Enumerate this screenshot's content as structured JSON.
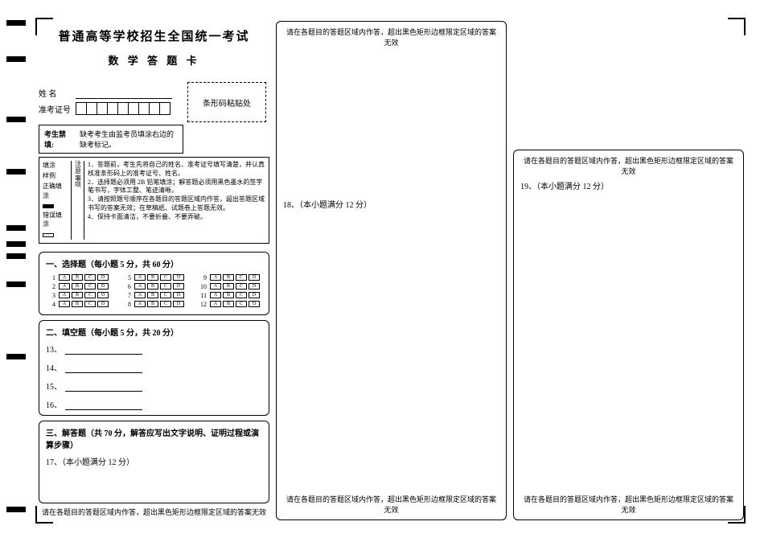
{
  "header": {
    "title": "普通高等学校招生全国统一考试",
    "subtitle": "数 学 答 题 卡"
  },
  "fields": {
    "name_label": "姓   名",
    "ticket_label": "准考证号"
  },
  "barcode": {
    "label": "条形码粘贴处"
  },
  "exam_notice": {
    "label": "考生禁填:",
    "text": "缺考考生由监考员填涂右边的缺考标记。"
  },
  "fill_example": {
    "title_line1": "填涂",
    "title_line2": "样例",
    "good_label": "正确填涂",
    "bad_label": "错误填涂"
  },
  "attention": {
    "vert_label": "注意事项",
    "rule1": "1．答题前，考生先将自己的姓名、准考证号填写清楚，并认真核准条形码上的准考证号、姓名。",
    "rule2": "2．选择题必须用 2B 铅笔填涂；解答题必须用黑色墨水的签字笔书写，字体工整、笔迹清晰。",
    "rule3": "3．请按照题号顺序在各题目的答题区域内作答，超出答题区域书写的答案无效；在草稿纸、试题卷上答题无效。",
    "rule4": "4．保持卡面清洁，不要折叠、不要弄破。"
  },
  "sections": {
    "mc_title": "一、选择题（每小题 5 分，共 60 分）",
    "fill_title": "二、填空题（每小题 5 分，共 20 分）",
    "essay_title": "三、解答题（共 70 分，解答应写出文字说明、证明过程或演算步骤）"
  },
  "mc": {
    "options": [
      "A",
      "B",
      "C",
      "D"
    ],
    "groups": [
      [
        "1",
        "2",
        "3",
        "4"
      ],
      [
        "5",
        "6",
        "7",
        "8"
      ],
      [
        "9",
        "10",
        "11",
        "12"
      ]
    ]
  },
  "fill_blanks": {
    "q13": "13、",
    "q14": "14、",
    "q15": "15、",
    "q16": "16、"
  },
  "essays": {
    "q17": "17、（本小题满分 12 分）",
    "q18": "18、（本小题满分 12 分）",
    "q19": "19、（本小题满分 12 分）"
  },
  "boundary_notice": "请在各题目的答题区域内作答，超出黑色矩形边框限定区域的答案无效"
}
